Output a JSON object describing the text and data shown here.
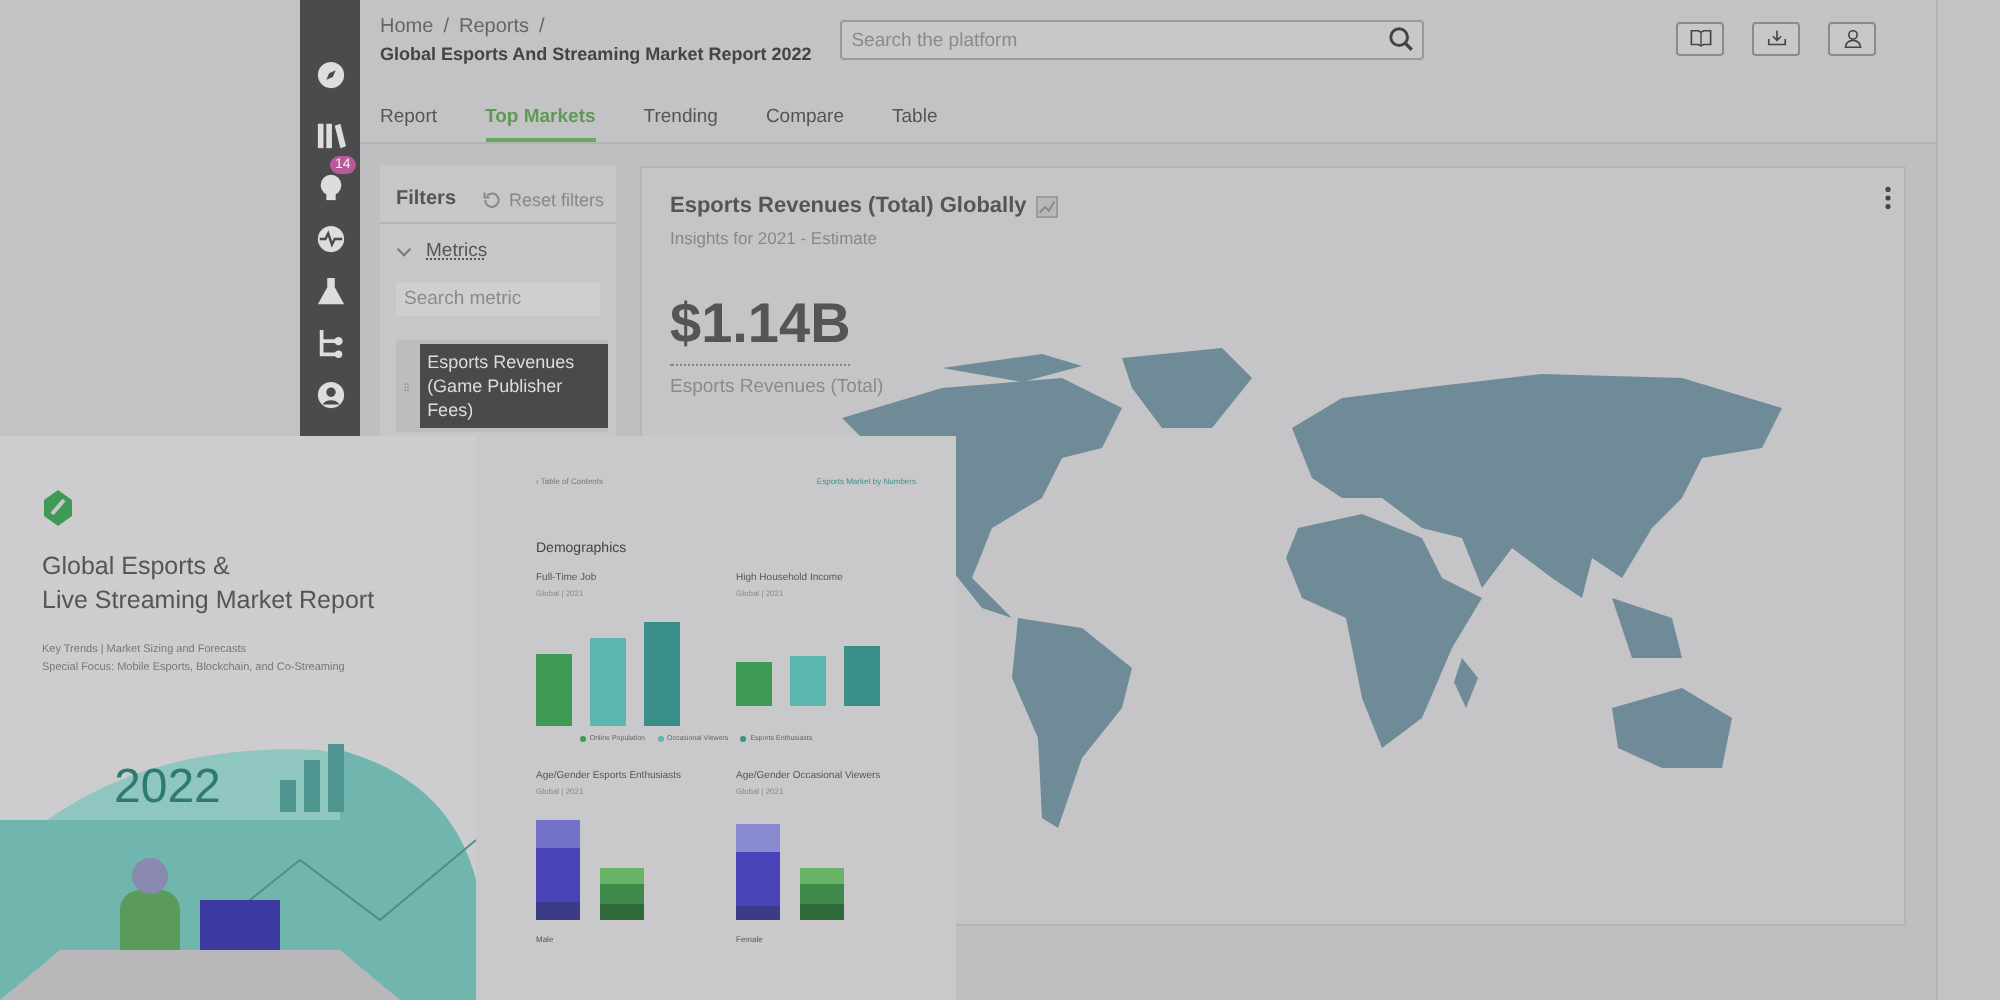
{
  "sidebar": {
    "items": [
      {
        "kind": "compass"
      },
      {
        "kind": "books"
      },
      {
        "kind": "bulb",
        "badge": "14"
      },
      {
        "kind": "pulse"
      },
      {
        "kind": "flask"
      },
      {
        "kind": "tree"
      },
      {
        "kind": "user"
      }
    ]
  },
  "header": {
    "breadcrumb": [
      {
        "label": "Home",
        "separator": "/"
      },
      {
        "label": "Reports",
        "separator": "/"
      }
    ],
    "title": "Global Esports And Streaming Market Report 2022",
    "search": {
      "placeholder": "Search the platform"
    },
    "actions": [
      {
        "kind": "book"
      },
      {
        "kind": "download"
      },
      {
        "kind": "user"
      }
    ]
  },
  "tabs": [
    {
      "label": "Report",
      "selected": false
    },
    {
      "label": "Top Markets",
      "selected": true
    },
    {
      "label": "Trending",
      "selected": false
    },
    {
      "label": "Compare",
      "selected": false
    },
    {
      "label": "Table",
      "selected": false
    }
  ],
  "filters": {
    "title": "Filters",
    "reset": "Reset filters",
    "section": {
      "label": "Metrics",
      "expanded": true
    },
    "search": {
      "placeholder": "Search metric"
    },
    "metrics": [
      {
        "label": "Esports Revenues (Game Publisher Fees)",
        "selected": true
      }
    ]
  },
  "card": {
    "title": "Esports Revenues (Total) Globally",
    "subtitle": "Insights for 2021 - Estimate",
    "value": "$1.14B",
    "value_label": "Esports Revenues (Total)"
  },
  "report_cover": {
    "title_lines": [
      "Global Esports &",
      "Live Streaming Market Report"
    ],
    "subtitle_lines": [
      "Key Trends | Market Sizing and Forecasts",
      "Special Focus: Mobile Esports, Blockchain, and Co-Streaming"
    ],
    "year": "2022"
  },
  "report_page": {
    "back_link": "‹ Table of Contents",
    "section_link": "Esports Market by Numbers",
    "heading": "Demographics",
    "charts": [
      {
        "title": "Full-Time Job",
        "subtitle": "Global | 2021"
      },
      {
        "title": "High Household Income",
        "subtitle": "Global | 2021"
      }
    ],
    "legend": [
      {
        "label": "Online Population",
        "color": "#3f9a55"
      },
      {
        "label": "Occasional Viewers",
        "color": "#5ab8b0"
      },
      {
        "label": "Esports Enthusiasts",
        "color": "#3a9088"
      }
    ],
    "stacked": [
      {
        "title": "Age/Gender Esports Enthusiasts",
        "subtitle": "Global | 2021",
        "legend_title": "Male"
      },
      {
        "title": "Age/Gender Occasional Viewers",
        "subtitle": "Global | 2021",
        "legend_title": "Female"
      }
    ]
  }
}
